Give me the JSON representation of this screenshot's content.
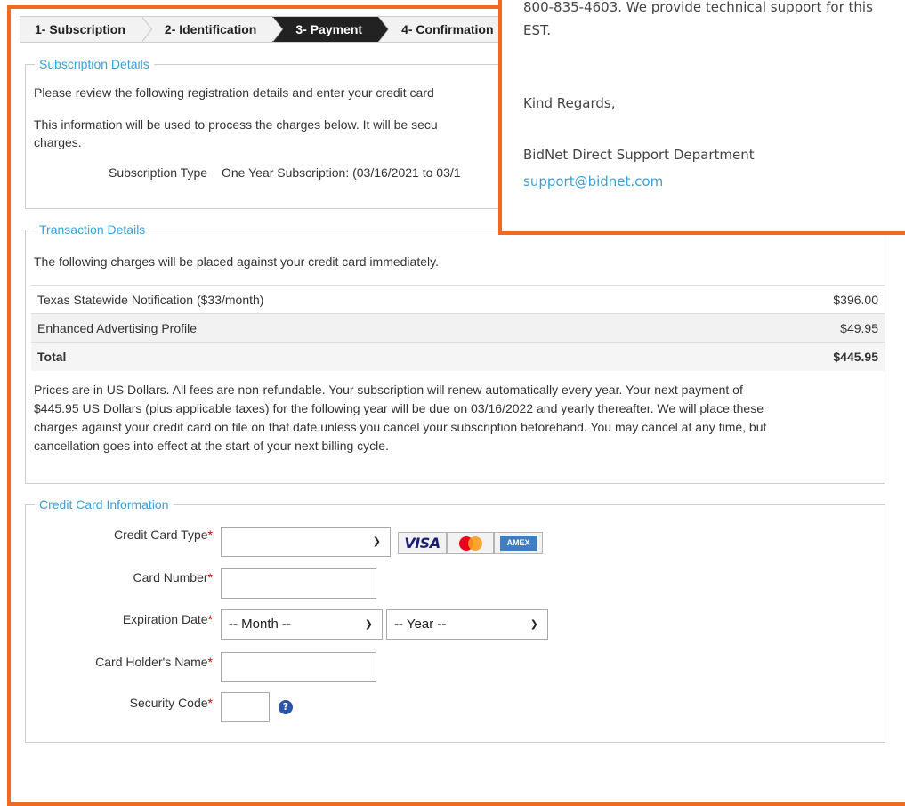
{
  "steps": [
    {
      "label": "1- Subscription",
      "active": false
    },
    {
      "label": "2- Identification",
      "active": false
    },
    {
      "label": "3- Payment",
      "active": true
    },
    {
      "label": "4- Confirmation",
      "active": false
    }
  ],
  "subscription": {
    "legend": "Subscription Details",
    "intro": "Please review the following registration details and enter your credit card",
    "info_line1": "This information will be used to process the charges below. It will be secu",
    "info_line2": "charges.",
    "type_label": "Subscription Type",
    "type_value": "One Year Subscription: (03/16/2021 to 03/1"
  },
  "transaction": {
    "legend": "Transaction Details",
    "intro": "The following charges will be placed against your credit card immediately.",
    "rows": [
      {
        "item": "Texas Statewide Notification ($33/month)",
        "amount": "$396.00"
      },
      {
        "item": "Enhanced Advertising Profile",
        "amount": "$49.95"
      }
    ],
    "total_label": "Total",
    "total_amount": "$445.95",
    "note_lines": [
      "Prices are in US Dollars. All fees are non-refundable. Your subscription will renew automatically every year. Your next payment of",
      "$445.95 US Dollars (plus applicable taxes) for the following year will be due on 03/16/2022 and yearly thereafter. We will place these",
      "charges against your credit card on file on that date unless you cancel your subscription beforehand. You may cancel at any time, but",
      "cancellation goes into effect at the start of your next billing cycle."
    ]
  },
  "credit_card": {
    "legend": "Credit Card Information",
    "required_mark": "*",
    "card_type_label": "Credit Card Type",
    "card_type_value": "",
    "card_number_label": "Card Number",
    "card_number_value": "",
    "expiration_label": "Expiration Date",
    "month_value": "-- Month --",
    "year_value": "-- Year --",
    "holder_label": "Card Holder's Name",
    "holder_value": "",
    "security_label": "Security Code",
    "security_value": "",
    "help_symbol": "?",
    "card_logos": {
      "visa": "VISA",
      "amex": "AMEX"
    }
  },
  "popup": {
    "line1": "800-835-4603. We provide technical support for this",
    "line2": "EST.",
    "regards": "Kind Regards,",
    "department": "BidNet Direct Support Department",
    "email": "support@bidnet.com"
  },
  "colors": {
    "accent": "#3aa0d8",
    "highlight": "#f26a21",
    "active_step": "#222222",
    "required": "#cc0000"
  }
}
